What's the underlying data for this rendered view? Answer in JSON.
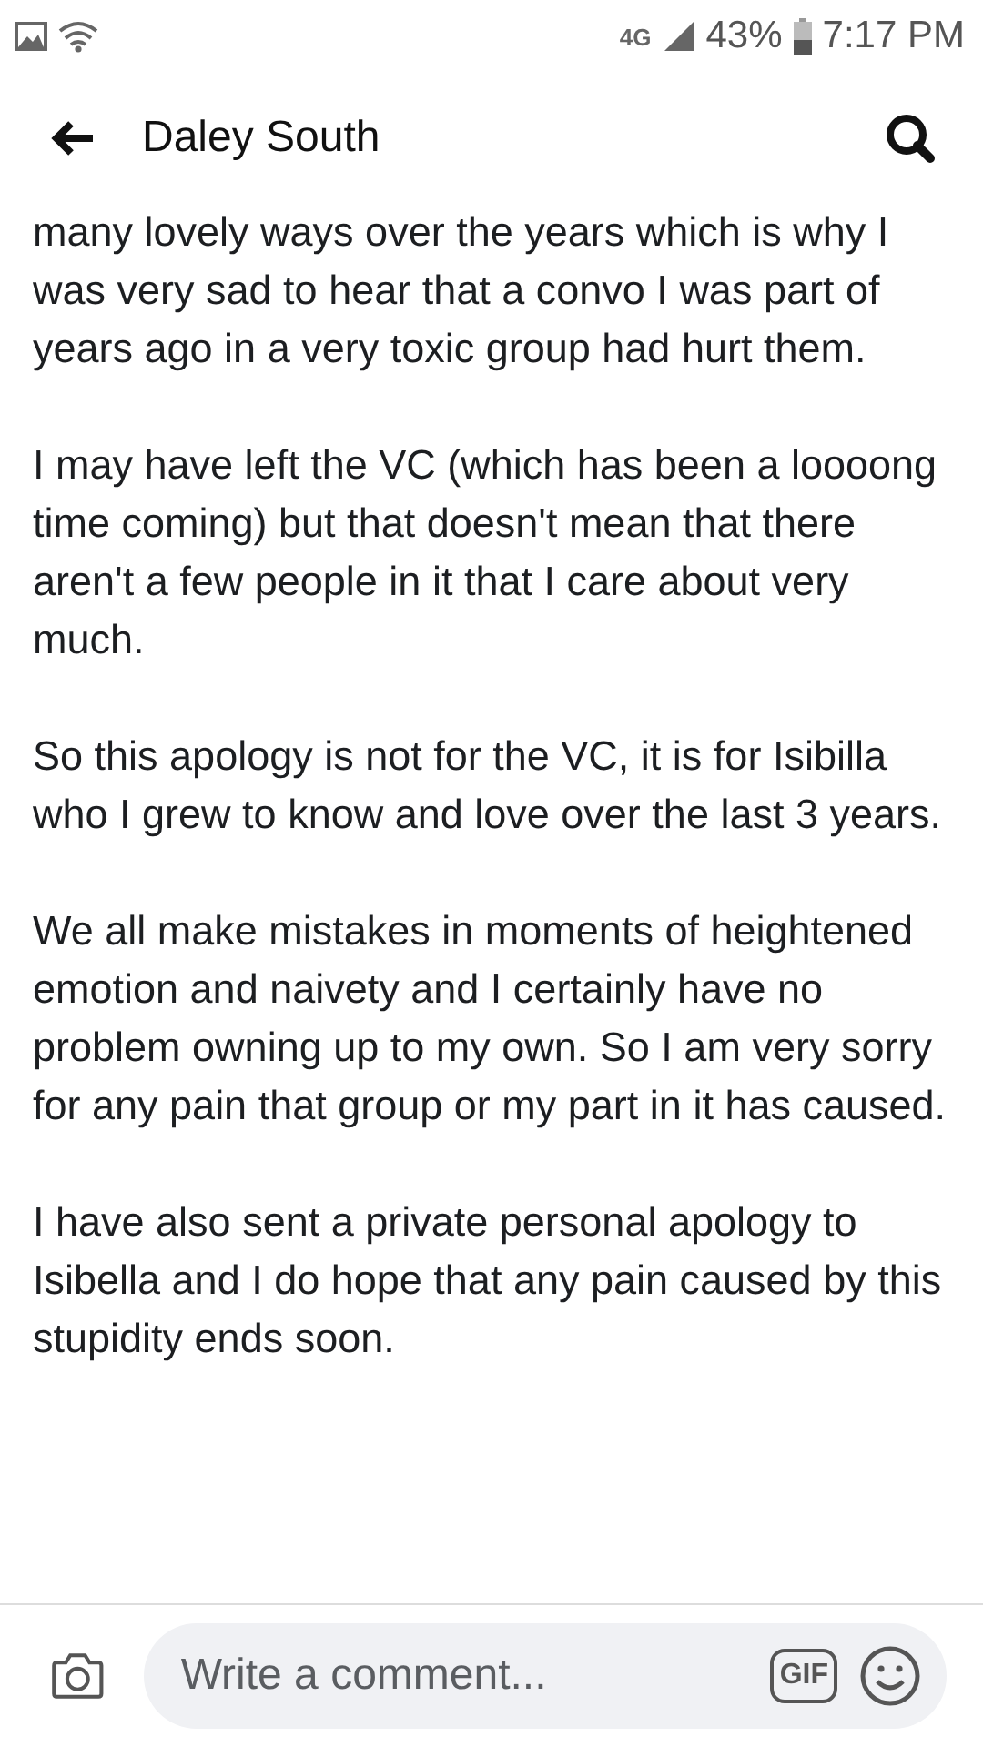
{
  "status_bar": {
    "network": "4G",
    "battery": "43%",
    "time": "7:17 PM"
  },
  "header": {
    "title": "Daley South"
  },
  "post": {
    "paragraphs": [
      "many lovely ways over the years which is why I was very sad to hear that a convo I was part of years ago in a very toxic group had hurt them.",
      "I may have left the VC (which has been a loooong time coming) but that doesn't mean that there aren't a few people in it that I care about very much.",
      "So this apology is not for the VC, it is for Isibilla who I grew to know and love over the last 3 years.",
      "We all make mistakes in moments of heightened emotion and naivety and I certainly have no problem owning up to my own. So I am very sorry for any pain that group or my part in it has caused.",
      "I have also sent a private personal apology to Isibella and I do hope that any pain caused by this stupidity ends soon."
    ]
  },
  "comment_bar": {
    "placeholder": "Write a comment...",
    "gif": "GIF"
  }
}
